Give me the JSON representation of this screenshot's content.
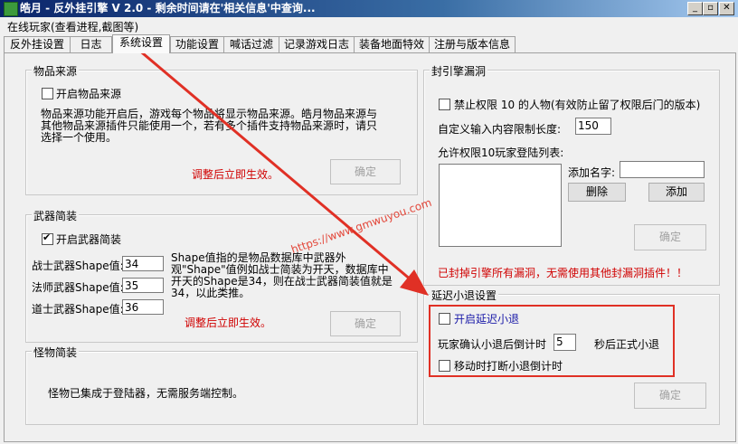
{
  "window": {
    "title": "皓月 - 反外挂引擎 V 2.0 - 剩余时间请在'相关信息'中查询...",
    "controls": {
      "minimize": "_",
      "restore": "▫",
      "close": "✕"
    }
  },
  "menu": {
    "online_players": "在线玩家(查看进程,截图等)"
  },
  "tabs": [
    "反外挂设置",
    "日志",
    "系统设置",
    "功能设置",
    "喊话过滤",
    "记录游戏日志",
    "装备地面特效",
    "注册与版本信息"
  ],
  "active_tab": "系统设置",
  "item_source": {
    "title": "物品来源",
    "enable_label": "开启物品来源",
    "enabled": false,
    "description": "物品来源功能开启后，游戏每个物品将显示物品来源。皓月物品来源与其他物品来源插件只能使用一个，若有多个插件支持物品来源时，请只选择一个使用。",
    "note": "调整后立即生效。",
    "confirm_label": "确定"
  },
  "weapon_brief": {
    "title": "武器简装",
    "enable_label": "开启武器简装",
    "enabled": true,
    "fields": [
      {
        "label": "战士武器Shape值:",
        "value": "34"
      },
      {
        "label": "法师武器Shape值:",
        "value": "35"
      },
      {
        "label": "道士武器Shape值:",
        "value": "36"
      }
    ],
    "description": "Shape值指的是物品数据库中武器外观\"Shape\"值例如战士简装为开天，数据库中开天的Shape是34，则在战士武器简装值就是34，以此类推。",
    "note": "调整后立即生效。",
    "confirm_label": "确定"
  },
  "monster_brief": {
    "title": "怪物简装",
    "description": "怪物已集成于登陆器，无需服务端控制。"
  },
  "seal_engine": {
    "title": "封引擎漏洞",
    "forbid_label": "禁止权限 10 的人物(有效防止留了权限后门的版本)",
    "forbid_enabled": false,
    "length_label": "自定义输入内容限制长度:",
    "length_value": "150",
    "allow_list_label": "允许权限10玩家登陆列表:",
    "allow_list": [],
    "add_name_label": "添加名字:",
    "add_name_value": "",
    "delete_label": "删除",
    "add_label": "添加",
    "confirm_label": "确定",
    "note": "已封掉引擎所有漏洞，无需使用其他封漏洞插件！！"
  },
  "delay_logout": {
    "title": "延迟小退设置",
    "enable_label": "开启延迟小退",
    "enabled": false,
    "countdown_prefix": "玩家确认小退后倒计时",
    "countdown_value": "5",
    "countdown_suffix": "秒后正式小退",
    "interrupt_label": "移动时打断小退倒计时",
    "interrupt_enabled": false,
    "confirm_label": "确定"
  },
  "watermark": {
    "text": "https://www.gmwuyou.com"
  },
  "colors": {
    "title_bar": "#0a246a",
    "note": "#d00000",
    "highlight_box": "#e03025",
    "arrow": "#e03025",
    "link": "#1a1aa8"
  }
}
